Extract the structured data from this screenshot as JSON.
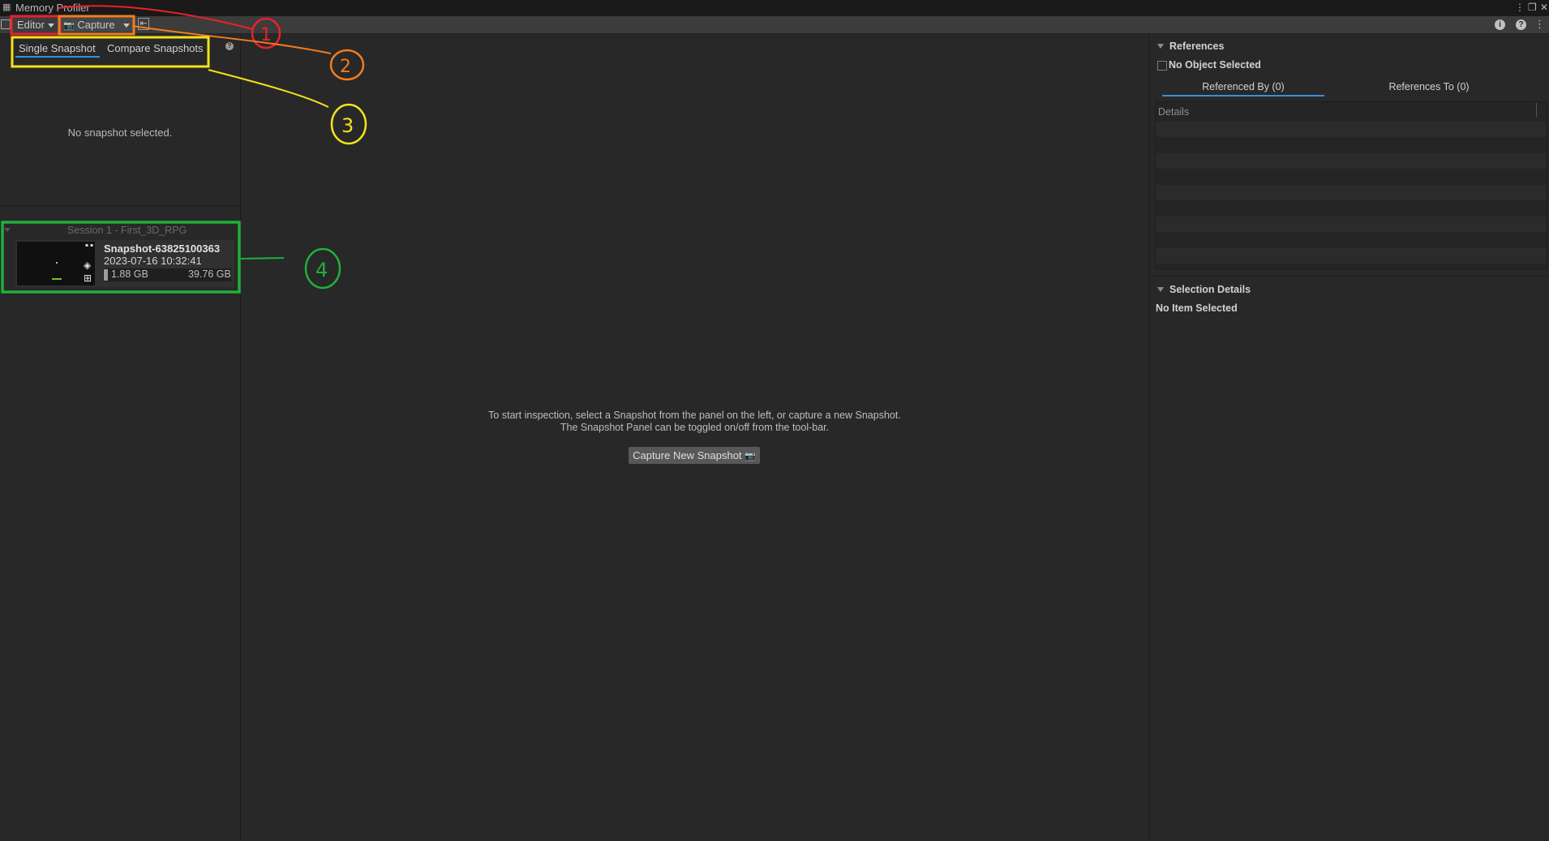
{
  "window": {
    "title": "Memory Profiler"
  },
  "toolbar": {
    "editor_label": "Editor",
    "capture_label": "Capture"
  },
  "left_panel": {
    "tabs": [
      {
        "label": "Single Snapshot",
        "active": true
      },
      {
        "label": "Compare Snapshots",
        "active": false
      }
    ],
    "empty_message": "No snapshot selected.",
    "session": {
      "label": "Session 1 - First_3D_RPG",
      "snapshots": [
        {
          "name": "Snapshot-63825100363",
          "date": "2023-07-16 10:32:41",
          "used": "1.88 GB",
          "total": "39.76 GB"
        }
      ]
    }
  },
  "center": {
    "hint_line1": "To start inspection, select a Snapshot from the panel on the left, or capture a new Snapshot.",
    "hint_line2": "The Snapshot Panel can be toggled on/off from the tool-bar.",
    "capture_button_label": "Capture New Snapshot"
  },
  "right_panel": {
    "references": {
      "title": "References",
      "no_object": "No Object Selected",
      "tabs": [
        {
          "label": "Referenced By (0)",
          "active": true
        },
        {
          "label": "References To (0)",
          "active": false
        }
      ],
      "table_header": "Details"
    },
    "selection_details": {
      "title": "Selection Details",
      "no_item": "No Item Selected"
    }
  },
  "colors": {
    "background": "#282828",
    "toolbar": "#3c3c3c",
    "accent_tab": "#3d8fd6"
  },
  "annotations": [
    {
      "label": "1",
      "color": "#e8222a"
    },
    {
      "label": "2",
      "color": "#f07d22"
    },
    {
      "label": "3",
      "color": "#f3e21c"
    },
    {
      "label": "4",
      "color": "#1fb03c"
    }
  ]
}
